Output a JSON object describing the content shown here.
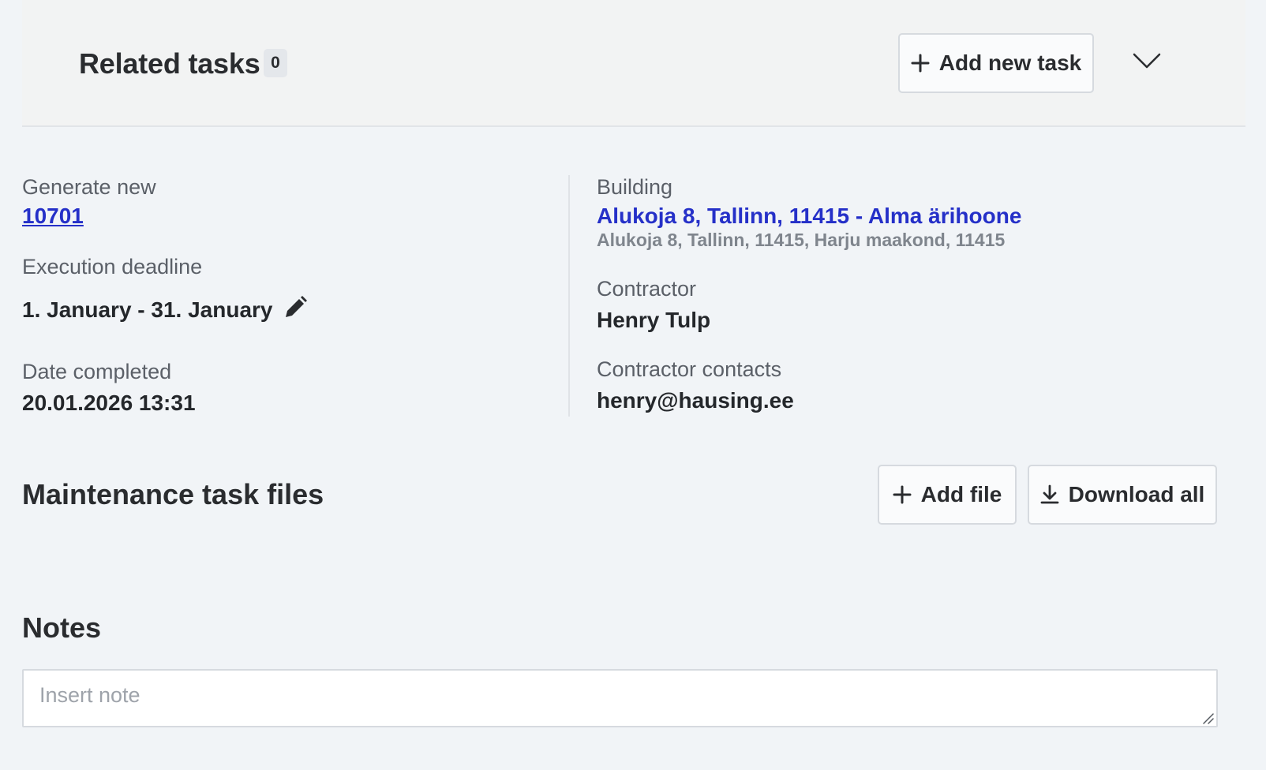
{
  "related_tasks": {
    "title": "Related tasks",
    "count": "0",
    "add_button_label": "Add new task"
  },
  "details": {
    "generate_new_label": "Generate new",
    "generate_new_value": "10701",
    "execution_deadline_label": "Execution deadline",
    "execution_deadline_value": "1. January - 31. January",
    "date_completed_label": "Date completed",
    "date_completed_value": "20.01.2026 13:31",
    "building_label": "Building",
    "building_name": "Alukoja 8, Tallinn, 11415 - Alma ärihoone",
    "building_address": "Alukoja 8, Tallinn, 11415, Harju maakond, 11415",
    "contractor_label": "Contractor",
    "contractor_value": "Henry Tulp",
    "contractor_contacts_label": "Contractor contacts",
    "contractor_contacts_value": "henry@hausing.ee"
  },
  "files": {
    "title": "Maintenance task files",
    "add_file_label": "Add file",
    "download_all_label": "Download all"
  },
  "notes": {
    "title": "Notes",
    "placeholder": "Insert note",
    "value": ""
  },
  "colors": {
    "link": "#2530c8",
    "background": "#f1f4f7",
    "header_panel": "#f2f3f3"
  },
  "icons": {
    "add_task": "plus-icon",
    "collapse": "chevron-down-icon",
    "edit_deadline": "pencil-icon",
    "add_file": "plus-icon",
    "download_all": "download-icon"
  }
}
